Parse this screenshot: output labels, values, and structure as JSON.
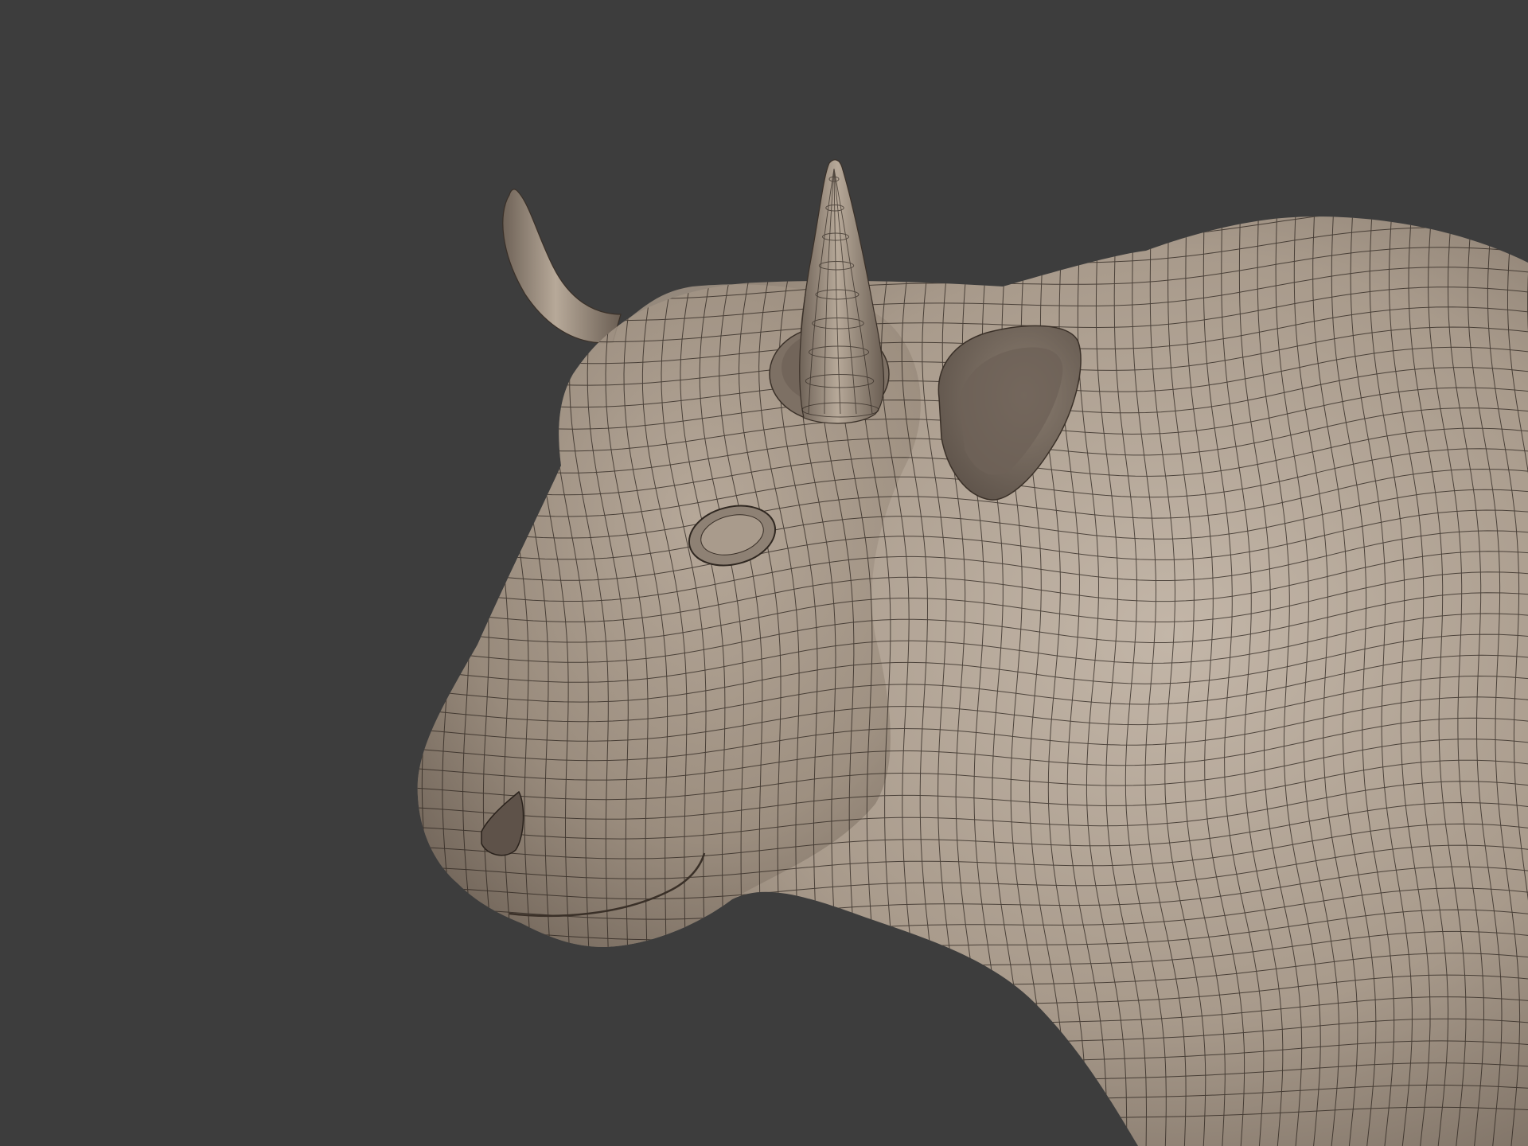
{
  "viewport": {
    "background_color": "#3d3d3d",
    "model": {
      "subject": "bull",
      "surface_color": "#a39484",
      "shadow_color": "#6e6257",
      "highlight_color": "#c3b6a8",
      "wire_color": "#2a221c",
      "display_mode": "subdivision-wireframe-overlay"
    }
  }
}
